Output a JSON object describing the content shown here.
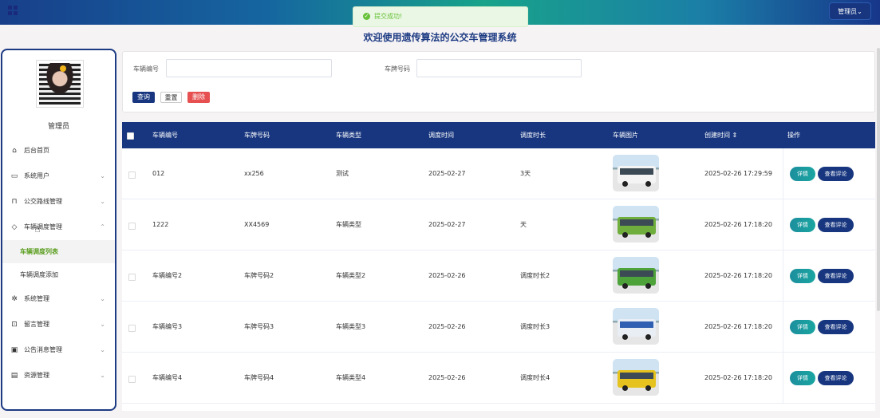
{
  "header": {
    "admin_label": "管理员⌄",
    "toast": "提交成功!",
    "page_title": "欢迎使用遗传算法的公交车管理系统"
  },
  "sidebar": {
    "username": "管理员",
    "items": [
      {
        "label": "后台首页",
        "icon": "home-icon"
      },
      {
        "label": "系统用户",
        "icon": "monitor-icon"
      },
      {
        "label": "公交路线管理",
        "icon": "bookmark-icon"
      },
      {
        "label": "车辆调度管理",
        "icon": "tag-icon"
      },
      {
        "label": "车辆调度列表"
      },
      {
        "label": "车辆调度添加"
      },
      {
        "label": "系统管理",
        "icon": "gear-icon"
      },
      {
        "label": "留言管理",
        "icon": "inbox-icon"
      },
      {
        "label": "公告消息管理",
        "icon": "clipboard-icon"
      },
      {
        "label": "资源管理",
        "icon": "message-icon"
      }
    ]
  },
  "search": {
    "vehicle_no_label": "车辆编号",
    "plate_label": "车牌号码",
    "query_button": "查询",
    "reset_button": "重置",
    "delete_button": "删除"
  },
  "table": {
    "columns": [
      "车辆编号",
      "车牌号码",
      "车辆类型",
      "调度时间",
      "调度时长",
      "车辆图片",
      "创建时间 ⇕",
      "操作"
    ],
    "rows": [
      {
        "no": "012",
        "plate": "xx256",
        "type": "测试",
        "date": "2025-02-27",
        "duration": "3天",
        "created": "2025-02-26 17:29:59"
      },
      {
        "no": "1222",
        "plate": "XX4569",
        "type": "车辆类型",
        "date": "2025-02-27",
        "duration": "天",
        "created": "2025-02-26 17:18:20"
      },
      {
        "no": "车辆编号2",
        "plate": "车牌号码2",
        "type": "车辆类型2",
        "date": "2025-02-26",
        "duration": "调度时长2",
        "created": "2025-02-26 17:18:20"
      },
      {
        "no": "车辆编号3",
        "plate": "车牌号码3",
        "type": "车辆类型3",
        "date": "2025-02-26",
        "duration": "调度时长3",
        "created": "2025-02-26 17:18:20"
      },
      {
        "no": "车辆编号4",
        "plate": "车牌号码4",
        "type": "车辆类型4",
        "date": "2025-02-26",
        "duration": "调度时长4",
        "created": "2025-02-26 17:18:20"
      }
    ],
    "detail_label": "详情",
    "review_label": "查看评论"
  },
  "colors": {
    "primary": "#17367f",
    "accent": "#1aa5a0",
    "danger": "#e65050",
    "active_menu": "#5b9e1f"
  }
}
